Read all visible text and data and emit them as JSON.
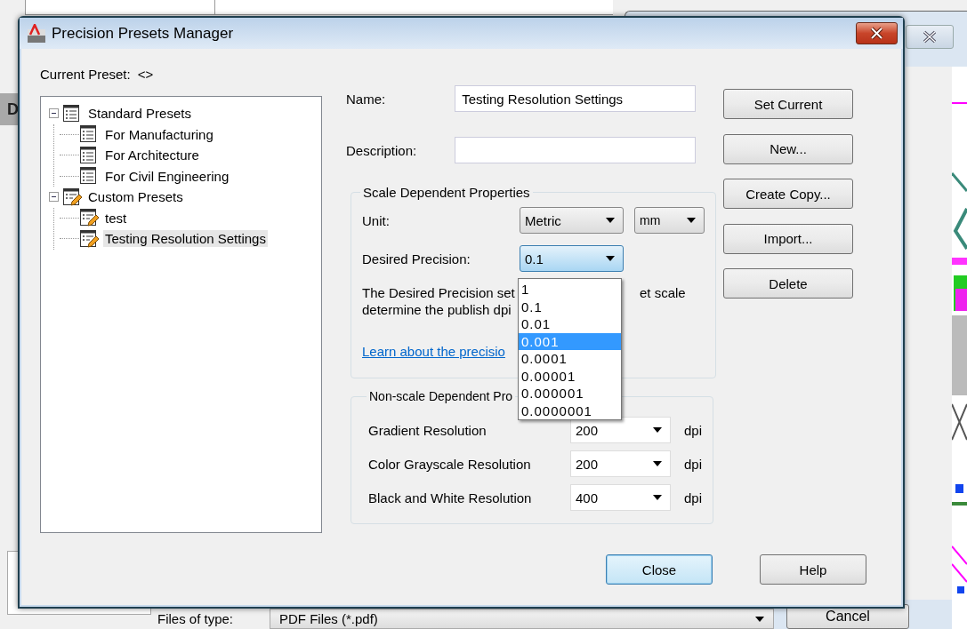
{
  "background_window": {
    "sidebar_letter": "D",
    "files_of_type_label": "Files of type:",
    "file_type_value": "PDF Files (*.pdf)",
    "cancel_button": "Cancel"
  },
  "dialog": {
    "title": "Precision Presets Manager",
    "current_preset_label": "Current Preset:",
    "current_preset_value": "<>",
    "tree": [
      {
        "label": "Standard Presets",
        "kind": "standard",
        "expanded": true,
        "selected": false,
        "children": [
          {
            "label": "For Manufacturing",
            "kind": "standard",
            "selected": false
          },
          {
            "label": "For Architecture",
            "kind": "standard",
            "selected": false
          },
          {
            "label": "For Civil Engineering",
            "kind": "standard",
            "selected": false
          }
        ]
      },
      {
        "label": "Custom Presets",
        "kind": "custom",
        "expanded": true,
        "selected": false,
        "children": [
          {
            "label": "test",
            "kind": "custom",
            "selected": false
          },
          {
            "label": "Testing Resolution Settings",
            "kind": "custom",
            "selected": true
          }
        ]
      }
    ],
    "name": {
      "label": "Name:",
      "value": "Testing Resolution Settings"
    },
    "description": {
      "label": "Description:"
    },
    "scale_group": {
      "title": "Scale Dependent Properties",
      "unit_label": "Unit:",
      "unit_system": "Metric",
      "unit": "mm",
      "precision_label": "Desired Precision:",
      "precision": "0.1",
      "precision_open": true,
      "options": [
        {
          "label": "1",
          "selected": false
        },
        {
          "label": "0.1",
          "selected": false
        },
        {
          "label": "0.01",
          "selected": false
        },
        {
          "label": "0.001",
          "selected": true
        },
        {
          "label": "0.0001",
          "selected": false
        },
        {
          "label": "0.00001",
          "selected": false
        },
        {
          "label": "0.000001",
          "selected": false
        },
        {
          "label": "0.0000001",
          "selected": false
        }
      ],
      "note_lines": [
        [
          "The Desired Precision set",
          "et scale"
        ],
        [
          "determine the publish dpi"
        ]
      ],
      "link": "Learn about the precisio"
    },
    "nonscale_group": {
      "title": "Non-scale Dependent Pro",
      "rows": [
        {
          "label": "Gradient Resolution",
          "value": "200",
          "unit": "dpi"
        },
        {
          "label": "Color Grayscale Resolution",
          "value": "200",
          "unit": "dpi"
        },
        {
          "label": "Black and White Resolution",
          "value": "400",
          "unit": "dpi"
        }
      ]
    },
    "side_buttons": [
      "Set Current",
      "New...",
      "Create Copy...",
      "Import...",
      "Delete"
    ],
    "footer_buttons": [
      {
        "label": "Close",
        "default": true
      },
      {
        "label": "Help",
        "default": false
      }
    ]
  }
}
